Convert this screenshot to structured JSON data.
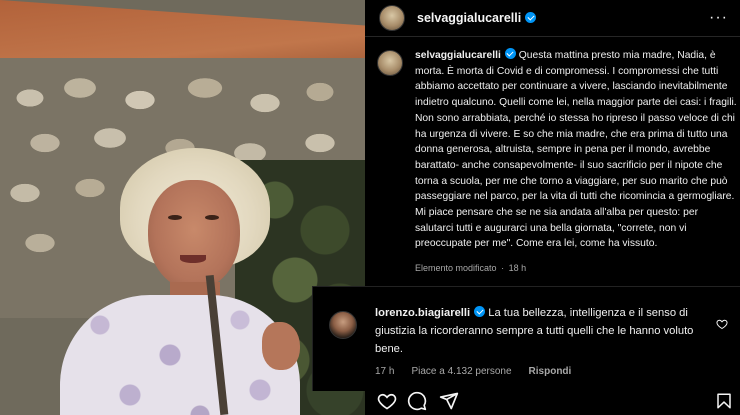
{
  "post": {
    "author": "selvaggialucarelli",
    "caption": "Questa mattina presto mia madre, Nadia, è morta. È morta di Covid e di compromessi. I compromessi che tutti abbiamo accettato per continuare a vivere, lasciando inevitabilmente indietro qualcuno. Quelli come lei, nella maggior parte dei casi: i fragili. Non sono arrabbiata, perché io stessa ho ripreso il passo veloce di chi ha urgenza di vivere. E so che mia madre, che era prima di tutto una donna generosa, altruista, sempre in pena per il mondo, avrebbe barattato- anche consapevolmente- il suo sacrificio per il nipote che torna a scuola, per me che torno a viaggiare, per suo marito che può passeggiare nel parco, per la vita di tutti che ricomincia a germogliare. Mi piace pensare che se ne sia andata all'alba per questo: per salutarci tutti e augurarci una bella giornata, \"correte, non vi preoccupate per me\". Come era lei, come ha vissuto.",
    "edited_label": "Elemento modificato",
    "separator": "·",
    "time": "18 h"
  },
  "comment": {
    "author": "lorenzo.biagiarelli",
    "text": "La tua bellezza, intelligenza e il senso di giustizia la ricorderanno sempre a tutti quelli che le hanno voluto bene.",
    "time": "17 h",
    "likes": "Piace a 4.132 persone",
    "reply": "Rispondi"
  },
  "header": {
    "more": "···"
  },
  "icons": {
    "verified": "verified-badge-icon",
    "more": "more-options-icon",
    "like": "heart-icon",
    "comment": "comment-icon",
    "share": "paper-plane-icon"
  },
  "colors": {
    "background": "#000000",
    "verified": "#0095f6",
    "secondary_text": "#a8a8a8"
  }
}
